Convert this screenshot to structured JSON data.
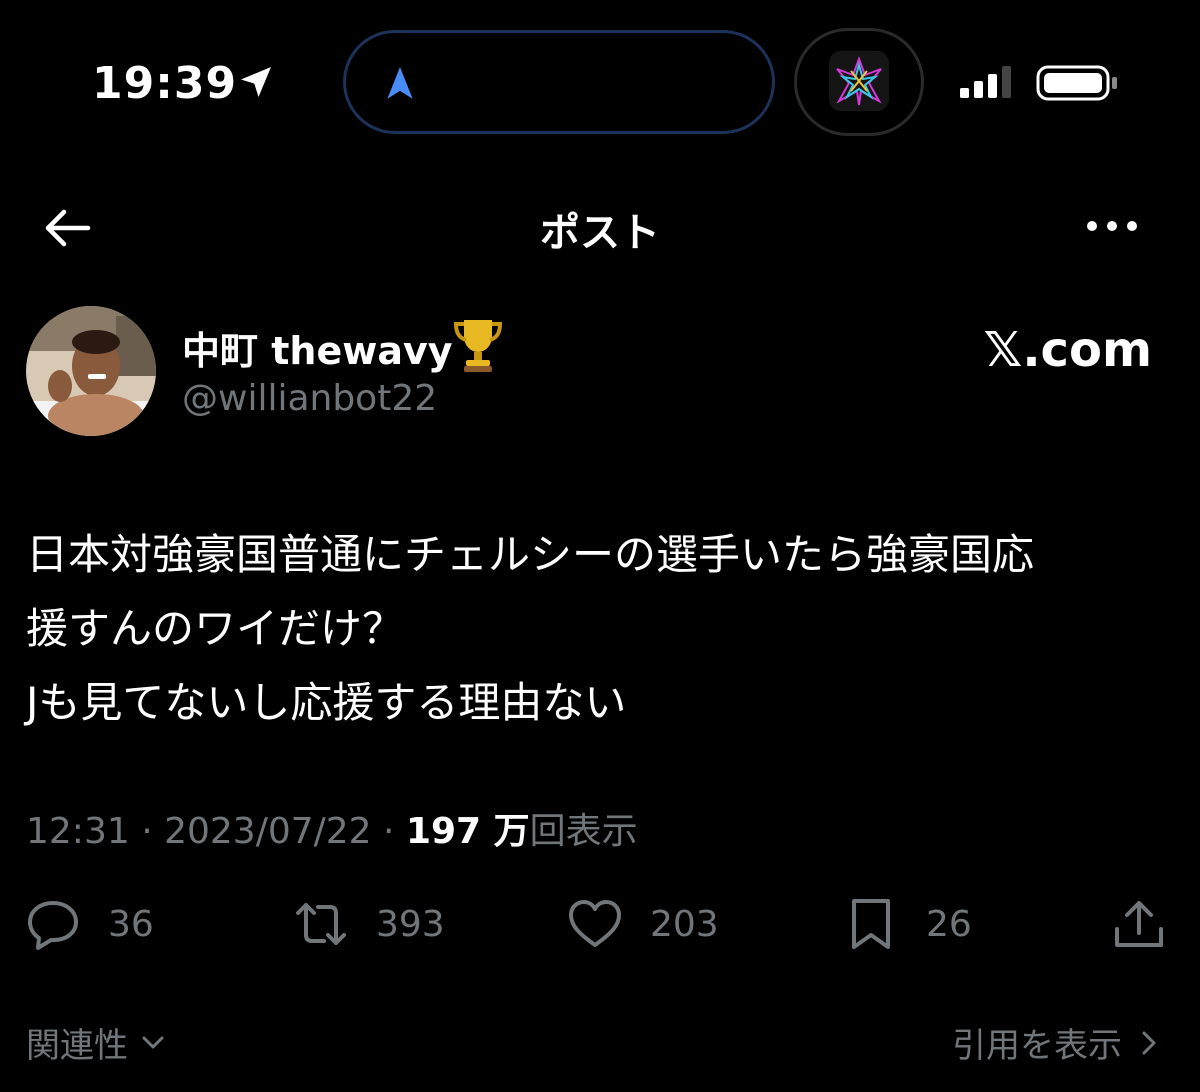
{
  "status_bar": {
    "time": "19:39",
    "location_icon": "location-arrow-icon",
    "nav_icon": "navigation-arrow-icon",
    "signal_icon": "cellular-signal-icon",
    "battery_icon": "battery-icon"
  },
  "header": {
    "title": "ポスト",
    "back_icon": "back-arrow-icon",
    "more_icon": "more-dots-icon"
  },
  "author": {
    "display_name": "中町 thewavy",
    "name_emoji": "🏆",
    "handle": "@willianbot22",
    "watermark": "𝕏.com"
  },
  "post": {
    "lines": [
      "日本対強豪国普通にチェルシーの選手いたら強豪国応",
      "援すんのワイだけ？",
      "Jも見てないし応援する理由ない"
    ]
  },
  "meta": {
    "time": "12:31",
    "sep1": " · ",
    "date": "2023/07/22",
    "sep2": " · ",
    "views_count": "197 万",
    "views_label": "回表示"
  },
  "actions": {
    "reply_count": "36",
    "retweet_count": "393",
    "like_count": "203",
    "bookmark_count": "26"
  },
  "footer": {
    "sort_label": "関連性",
    "quotes_label": "引用を表示"
  },
  "colors": {
    "background": "#000000",
    "text_primary": "#ffffff",
    "text_secondary": "#71767b",
    "nav_accent": "#4a8cf7"
  }
}
